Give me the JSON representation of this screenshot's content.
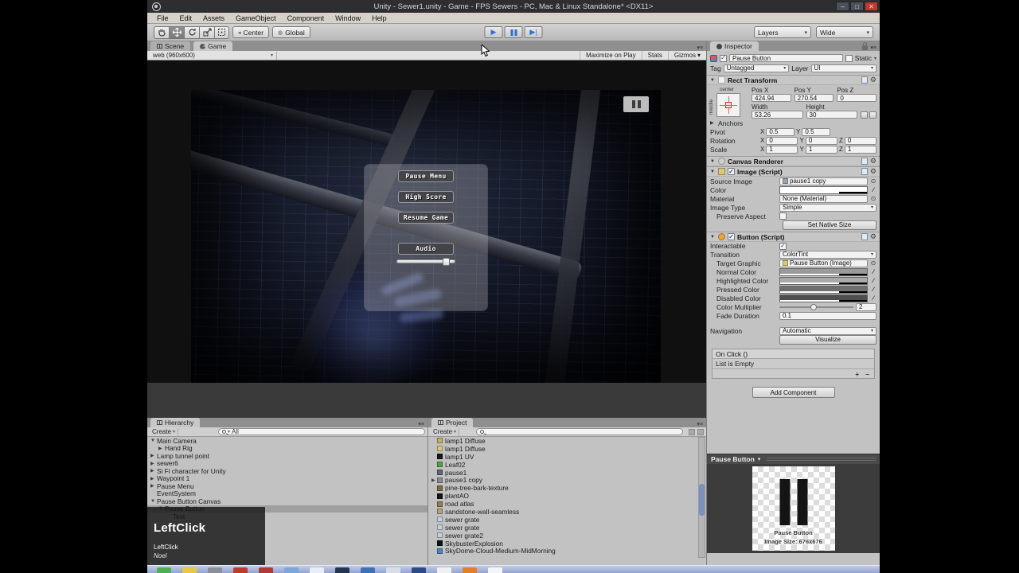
{
  "window": {
    "title": "Unity - Sewer1.unity - Game - FPS Sewers - PC, Mac & Linux Standalone* <DX11>",
    "menu": [
      "File",
      "Edit",
      "Assets",
      "GameObject",
      "Component",
      "Window",
      "Help"
    ],
    "buttons": {
      "minimize": "–",
      "maximize": "□",
      "close": "✕"
    }
  },
  "toolbar": {
    "center": "Center",
    "global": "Global",
    "layers": "Layers",
    "layout": "Wide"
  },
  "tabs": {
    "scene": "Scene",
    "game": "Game"
  },
  "game_bar": {
    "aspect": "web (960x600)",
    "maximize_on_play": "Maximize on Play",
    "stats": "Stats",
    "gizmos": "Gizmos"
  },
  "game": {
    "pause_buttons": [
      "Pause Menu",
      "High Score",
      "Resume Game"
    ],
    "audio_label": "Audio",
    "volume_percent": 92
  },
  "hierarchy": {
    "tab": "Hierarchy",
    "create": "Create",
    "search_filter": "All",
    "items": [
      {
        "label": "Main Camera",
        "arrow": "▼",
        "indent": 0,
        "selected": false
      },
      {
        "label": "Hand Rig",
        "arrow": "▶",
        "indent": 1,
        "selected": false
      },
      {
        "label": "Lamp tunnel point",
        "arrow": "▶",
        "indent": 0,
        "selected": false
      },
      {
        "label": "sewer6",
        "arrow": "▶",
        "indent": 0,
        "selected": false
      },
      {
        "label": "Si Fi character for Unity",
        "arrow": "▶",
        "indent": 0,
        "selected": false
      },
      {
        "label": "Waypoint 1",
        "arrow": "▶",
        "indent": 0,
        "selected": false
      },
      {
        "label": "Pause Menu",
        "arrow": "▶",
        "indent": 0,
        "selected": false
      },
      {
        "label": "EventSystem",
        "arrow": "",
        "indent": 0,
        "selected": false
      },
      {
        "label": "Pause Button Canvas",
        "arrow": "▼",
        "indent": 0,
        "selected": false
      },
      {
        "label": "Pause Button",
        "arrow": "▼",
        "indent": 1,
        "selected": true
      },
      {
        "label": "Text",
        "arrow": "",
        "indent": 2,
        "selected": false
      }
    ]
  },
  "project": {
    "tab": "Project",
    "create": "Create",
    "items": [
      {
        "label": "lamp1 Diffuse",
        "color": "#c9b06a",
        "arrow": ""
      },
      {
        "label": "lamp1 Diffuse",
        "color": "#d9c87e",
        "arrow": ""
      },
      {
        "label": "lamp1 UV",
        "color": "#16161a",
        "arrow": ""
      },
      {
        "label": "Leaf02",
        "color": "#58a048",
        "arrow": ""
      },
      {
        "label": "pause1",
        "color": "#63666d",
        "arrow": ""
      },
      {
        "label": "pause1 copy",
        "color": "#8a8d94",
        "arrow": "▶"
      },
      {
        "label": "pine-tree-bark-texture",
        "color": "#7d6b49",
        "arrow": ""
      },
      {
        "label": "plantAO",
        "color": "#141414",
        "arrow": ""
      },
      {
        "label": "road atlas",
        "color": "#8f7f52",
        "arrow": ""
      },
      {
        "label": "sandstone-wall-seamless",
        "color": "#b3a27e",
        "arrow": ""
      },
      {
        "label": "sewer  grate",
        "color": "#c3d2dd",
        "arrow": ""
      },
      {
        "label": "sewer  grate",
        "color": "#c3d2dd",
        "arrow": ""
      },
      {
        "label": "sewer  grate2",
        "color": "#c3d2dd",
        "arrow": ""
      },
      {
        "label": "SkybusterExplosion",
        "color": "#101014",
        "arrow": ""
      },
      {
        "label": "SkyDome-Cloud-Medium-MidMorning",
        "color": "#4a86c8",
        "arrow": ""
      }
    ]
  },
  "inspector": {
    "tab": "Inspector",
    "object_name": "Pause Button",
    "static_label": "Static",
    "tag_label": "Tag",
    "tag_value": "Untagged",
    "layer_label": "Layer",
    "layer_value": "UI",
    "rect_transform": {
      "title": "Rect Transform",
      "anchor_h": "center",
      "anchor_v": "middle",
      "pos_x_label": "Pos X",
      "pos_y_label": "Pos Y",
      "pos_z_label": "Pos Z",
      "pos_x": "424.94",
      "pos_y": "270.54",
      "pos_z": "0",
      "width_label": "Width",
      "height_label": "Height",
      "width": "53.26",
      "height": "30",
      "anchors_label": "Anchors",
      "pivot_label": "Pivot",
      "pivot_x": "0.5",
      "pivot_y": "0.5",
      "rotation_label": "Rotation",
      "rot_x": "0",
      "rot_y": "0",
      "rot_z": "0",
      "scale_label": "Scale",
      "scale_x": "1",
      "scale_y": "1",
      "scale_z": "1",
      "x_label": "X",
      "y_label": "Y",
      "z_label": "Z"
    },
    "canvas_renderer": {
      "title": "Canvas Renderer"
    },
    "image": {
      "title": "Image (Script)",
      "source_label": "Source Image",
      "source_value": "pause1 copy",
      "color_label": "Color",
      "material_label": "Material",
      "material_value": "None (Material)",
      "type_label": "Image Type",
      "type_value": "Simple",
      "preserve_label": "Preserve Aspect",
      "native_button": "Set Native Size"
    },
    "button": {
      "title": "Button (Script)",
      "interactable_label": "Interactable",
      "transition_label": "Transition",
      "transition_value": "ColorTint",
      "target_label": "Target Graphic",
      "target_value": "Pause Button (Image)",
      "colors": [
        {
          "label": "Normal Color",
          "hex": "#9a9a9a"
        },
        {
          "label": "Highlighted Color",
          "hex": "#a9a9a9"
        },
        {
          "label": "Pressed Color",
          "hex": "#707070"
        },
        {
          "label": "Disabled Color",
          "hex": "#4e4e4e"
        }
      ],
      "multiplier_label": "Color Multiplier",
      "multiplier_value": "2",
      "fade_label": "Fade Duration",
      "fade_value": "0.1",
      "navigation_label": "Navigation",
      "navigation_value": "Automatic",
      "visualize_button": "Visualize"
    },
    "on_click": {
      "title": "On Click ()",
      "empty": "List is Empty",
      "add": "+",
      "remove": "–"
    },
    "add_component": "Add Component"
  },
  "preview": {
    "title": "Pause Button",
    "caption_name": "Pause Button",
    "caption_size": "Image Size: 676x676"
  },
  "overlay": {
    "big": "LeftClick",
    "small": "LeftClick",
    "note": "Noel"
  },
  "taskbar": {
    "icons": [
      "#4caf50",
      "#e7c944",
      "#8a8f98",
      "#c0392b",
      "#b23b2e",
      "#7fa6d9",
      "#e8eef8",
      "#22364f",
      "#3f6fb5",
      "#d8dde6",
      "#2d4a86",
      "#f0f0f0",
      "#e67e22",
      "#f5f5f5"
    ]
  }
}
